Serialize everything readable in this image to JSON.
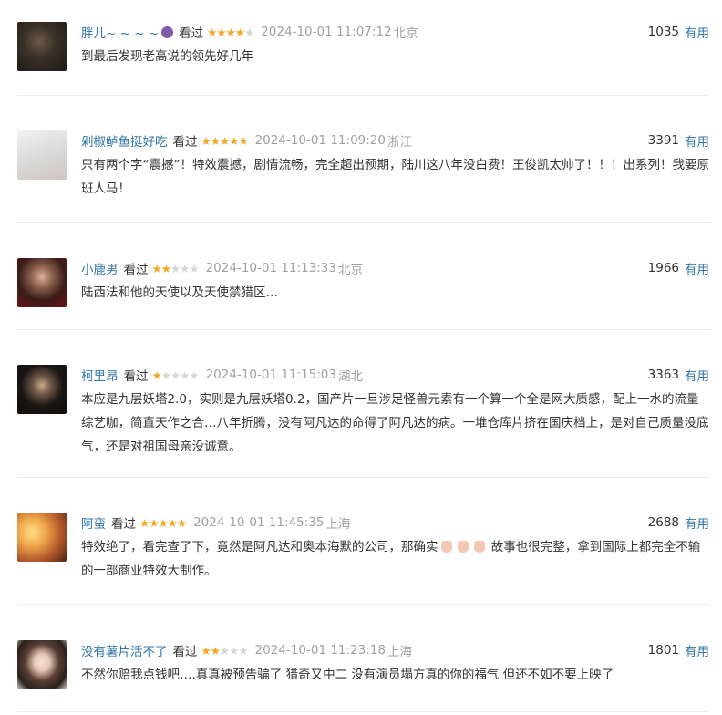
{
  "reviews": [
    {
      "user": "胖儿~ ~ ~ ~",
      "status": "看过",
      "stars": 4,
      "time": "2024-10-01 11:07:12",
      "location": "北京",
      "votes": "1035",
      "useful_label": "有用",
      "text": "到最后发现老高说的领先好几年",
      "avatar_icon": "dark-figure-avatar"
    },
    {
      "user": "剁椒鲈鱼挺好吃",
      "status": "看过",
      "stars": 5,
      "time": "2024-10-01 11:09:20",
      "location": "浙江",
      "votes": "3391",
      "useful_label": "有用",
      "text": "只有两个字“震撼”！特效震撼，剧情流畅，完全超出预期，陆川这八年没白费！王俊凯太帅了！！！出系列！我要原班人马！",
      "avatar_icon": "girl-avatar"
    },
    {
      "user": "小鹿男",
      "status": "看过",
      "stars": 2,
      "time": "2024-10-01 11:13:33",
      "location": "北京",
      "votes": "1966",
      "useful_label": "有用",
      "text": "陆西法和他的天使以及天使禁猎区…",
      "avatar_icon": "boy-avatar"
    },
    {
      "user": "柯里昂",
      "status": "看过",
      "stars": 1,
      "time": "2024-10-01 11:15:03",
      "location": "湖北",
      "votes": "3363",
      "useful_label": "有用",
      "text": "本应是九层妖塔2.0，实则是九层妖塔0.2，国产片一旦涉足怪兽元素有一个算一个全是网大质感，配上一水的流量综艺咖，简直天作之合…八年折腾，没有阿凡达的命得了阿凡达的病。一堆仓库片挤在国庆档上，是对自己质量没底气，还是对祖国母亲没诚意。",
      "avatar_icon": "godfather-avatar"
    },
    {
      "user": "阿蛮",
      "status": "看过",
      "stars": 5,
      "time": "2024-10-01 11:45:35",
      "location": "上海",
      "votes": "2688",
      "useful_label": "有用",
      "text_before": "特效绝了，看完查了下，竟然是阿凡达和奥本海默的公司，那确实",
      "text_after": "故事也很完整，拿到国际上都完全不输的一部商业特效大制作。",
      "avatar_icon": "light-avatar"
    },
    {
      "user": "没有薯片活不了",
      "status": "看过",
      "stars": 2,
      "time": "2024-10-01 11:23:18",
      "location": "上海",
      "votes": "1801",
      "useful_label": "有用",
      "text": "不然你赔我点钱吧….真真被预告骗了 猎奇又中二 没有演员塌方真的你的福气 但还不如不要上映了",
      "avatar_icon": "woman-avatar"
    }
  ]
}
